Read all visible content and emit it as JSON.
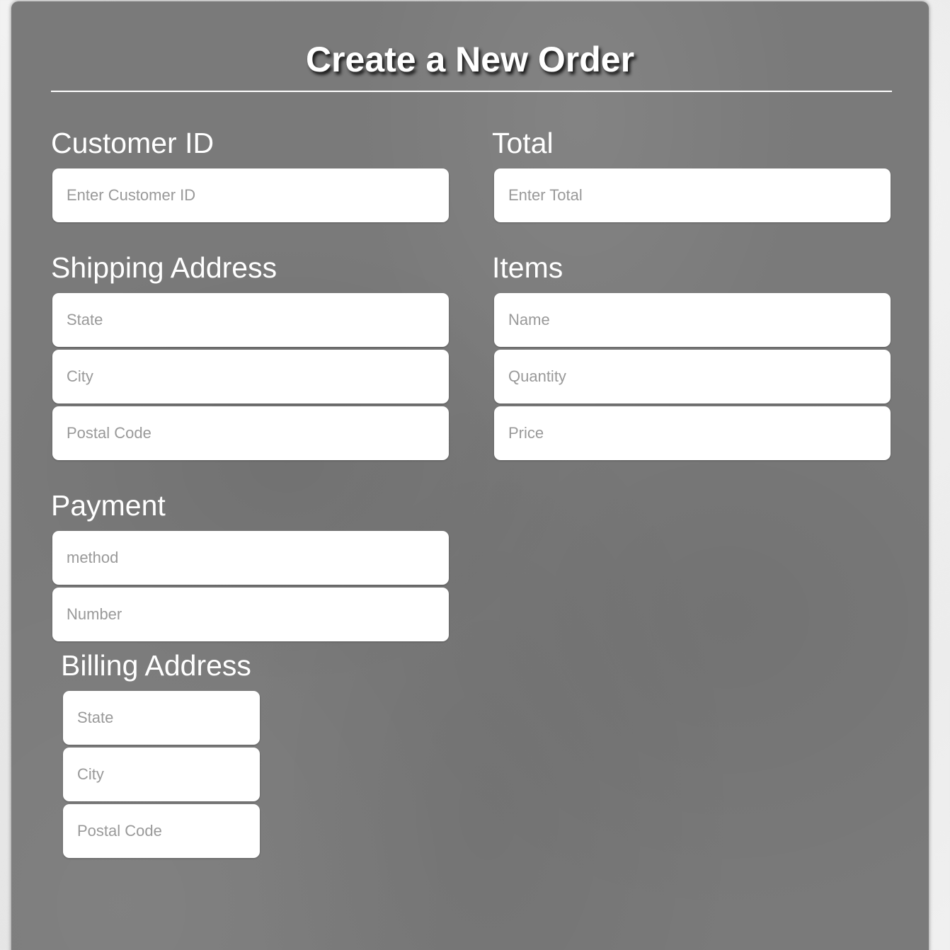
{
  "page": {
    "title": "Create a New Order"
  },
  "customer": {
    "label": "Customer ID",
    "placeholder": "Enter Customer ID"
  },
  "total": {
    "label": "Total",
    "placeholder": "Enter Total"
  },
  "shipping": {
    "label": "Shipping Address",
    "state_placeholder": "State",
    "city_placeholder": "City",
    "postal_placeholder": "Postal Code"
  },
  "items": {
    "label": "Items",
    "name_placeholder": "Name",
    "quantity_placeholder": "Quantity",
    "price_placeholder": "Price"
  },
  "payment": {
    "label": "Payment",
    "method_placeholder": "method",
    "number_placeholder": "Number"
  },
  "billing": {
    "label": "Billing Address",
    "state_placeholder": "State",
    "city_placeholder": "City",
    "postal_placeholder": "Postal Code"
  },
  "colors": {
    "panel_background": "#7a7a7a",
    "page_background": "#eeeeee",
    "text": "#ffffff",
    "input_background": "#ffffff",
    "placeholder": "#999999"
  }
}
